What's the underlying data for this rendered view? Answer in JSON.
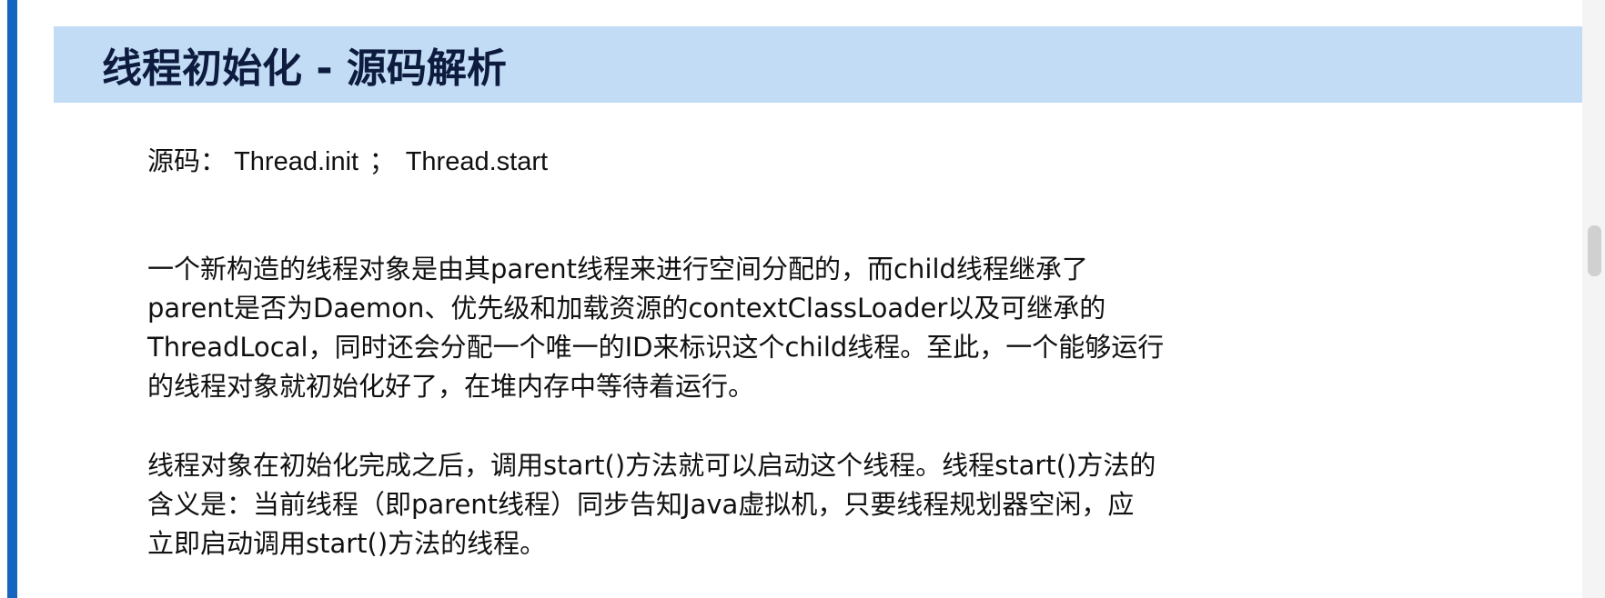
{
  "slide": {
    "title": "线程初始化 - 源码解析",
    "source": {
      "label": "源码：",
      "item1": "Thread.init",
      "separator": "；",
      "item2": "Thread.start"
    },
    "paragraph1": {
      "lines": [
        "一个新构造的线程对象是由其parent线程来进行空间分配的，而child线程继承了",
        "parent是否为Daemon、优先级和加载资源的contextClassLoader以及可继承的",
        "ThreadLocal，同时还会分配一个唯一的ID来标识这个child线程。至此，一个能够运行",
        "的线程对象就初始化好了，在堆内存中等待着运行。"
      ]
    },
    "paragraph2": {
      "lines": [
        "线程对象在初始化完成之后，调用start()方法就可以启动这个线程。线程start()方法的",
        "含义是：当前线程（即parent线程）同步告知Java虚拟机，只要线程规划器空闲，应",
        "立即启动调用start()方法的线程。"
      ]
    }
  },
  "colors": {
    "accent_bar": "#1565c0",
    "title_band": "#c2dcf5",
    "title_text": "#0d1b3e"
  }
}
